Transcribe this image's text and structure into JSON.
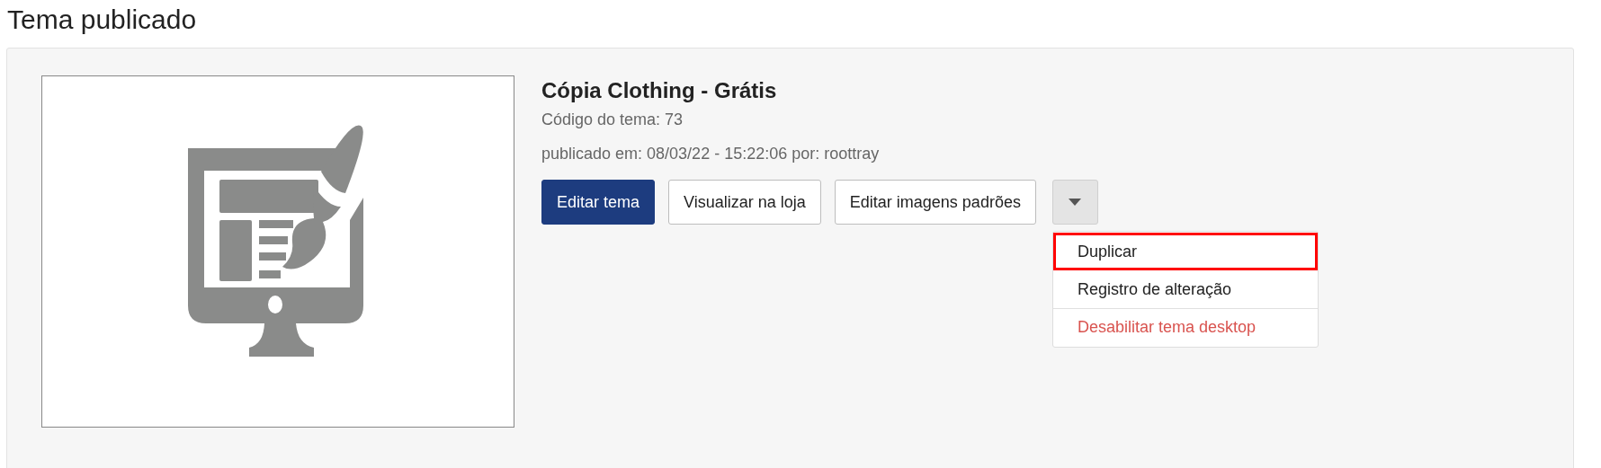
{
  "page_title": "Tema publicado",
  "theme": {
    "name": "Cópia Clothing - Grátis",
    "code": "Código do tema: 73",
    "published": "publicado em: 08/03/22 - 15:22:06 por: roottray"
  },
  "buttons": [
    {
      "label": "Editar tema",
      "kind": "primary"
    },
    {
      "label": "Visualizar na loja",
      "kind": "default"
    },
    {
      "label": "Editar imagens padrões",
      "kind": "default"
    }
  ],
  "dropdown": {
    "expanded": true,
    "items": [
      {
        "label": "Duplicar",
        "kind": "normal",
        "highlighted": true
      },
      {
        "label": "Registro de alteração",
        "kind": "normal",
        "highlighted": false
      },
      {
        "label": "Desabilitar tema desktop",
        "kind": "danger",
        "highlighted": false
      }
    ]
  }
}
